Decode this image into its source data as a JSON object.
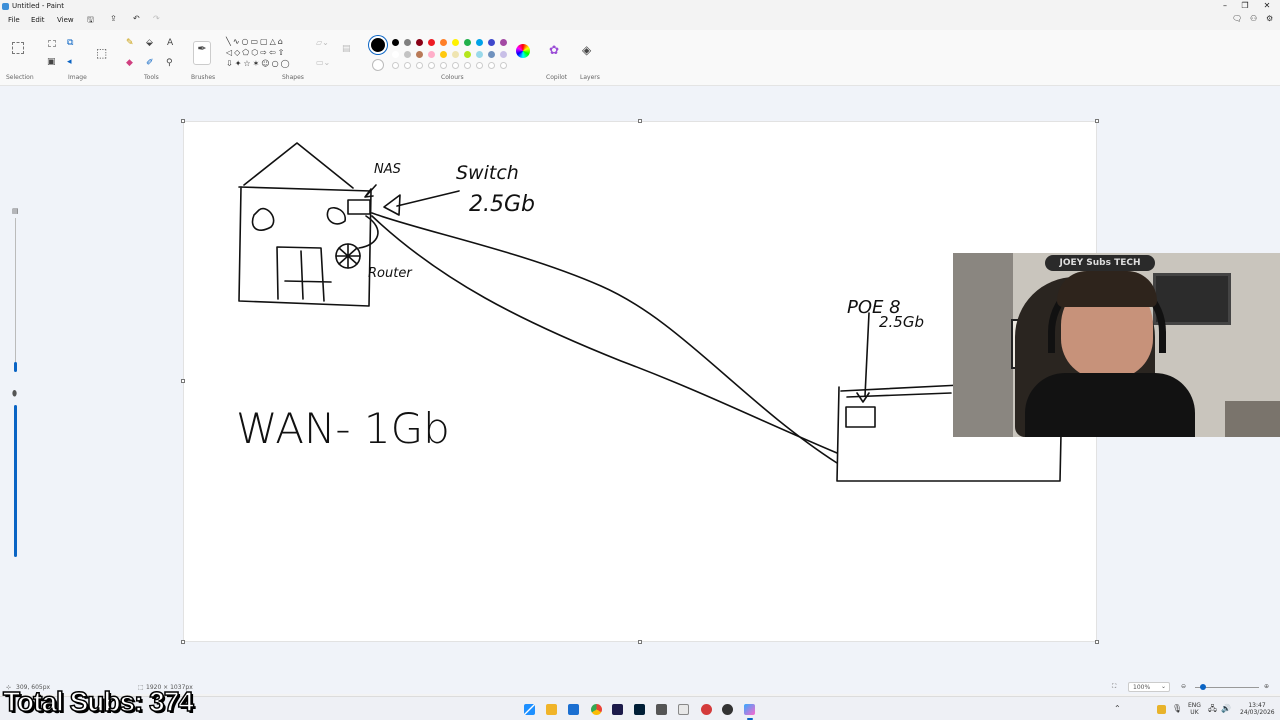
{
  "window": {
    "title": "Untitled - Paint"
  },
  "menu": {
    "file": "File",
    "edit": "Edit",
    "view": "View"
  },
  "ribbon": {
    "groups": {
      "selection": "Selection",
      "image": "Image",
      "tools": "Tools",
      "brushes": "Brushes",
      "shapes": "Shapes",
      "colours": "Colours",
      "copilot": "Copilot",
      "layers": "Layers"
    },
    "text_tool_glyph": "A"
  },
  "colours": {
    "selected": "#000000",
    "row1": [
      "#000000",
      "#7f7f7f",
      "#880015",
      "#ed1c24",
      "#ff7f27",
      "#fff200",
      "#22b14c",
      "#00a2e8",
      "#3f48cc",
      "#a349a4"
    ],
    "row2": [
      "#ffffff",
      "#c3c3c3",
      "#b97a57",
      "#ffaec9",
      "#ffc90e",
      "#efe4b0",
      "#b5e61d",
      "#99d9ea",
      "#7092be",
      "#c8bfe7"
    ]
  },
  "drawing": {
    "nas": "NAS",
    "switch": "Switch",
    "switch_speed": "2.5Gb",
    "router": "Router",
    "poe": "POE 8",
    "poe_speed": "2.5Gb",
    "wan": "WAN- 1Gb"
  },
  "webcam": {
    "banner": "JOEY Subs TECH"
  },
  "status": {
    "cursor_pos": "309, 605px",
    "canvas_size": "1920 × 1037px",
    "zoom": "100%"
  },
  "overlay": {
    "subs": "Total Subs: 374"
  },
  "tray": {
    "lang1": "ENG",
    "lang2": "UK",
    "time": "13:47",
    "date": "24/03/2026"
  }
}
